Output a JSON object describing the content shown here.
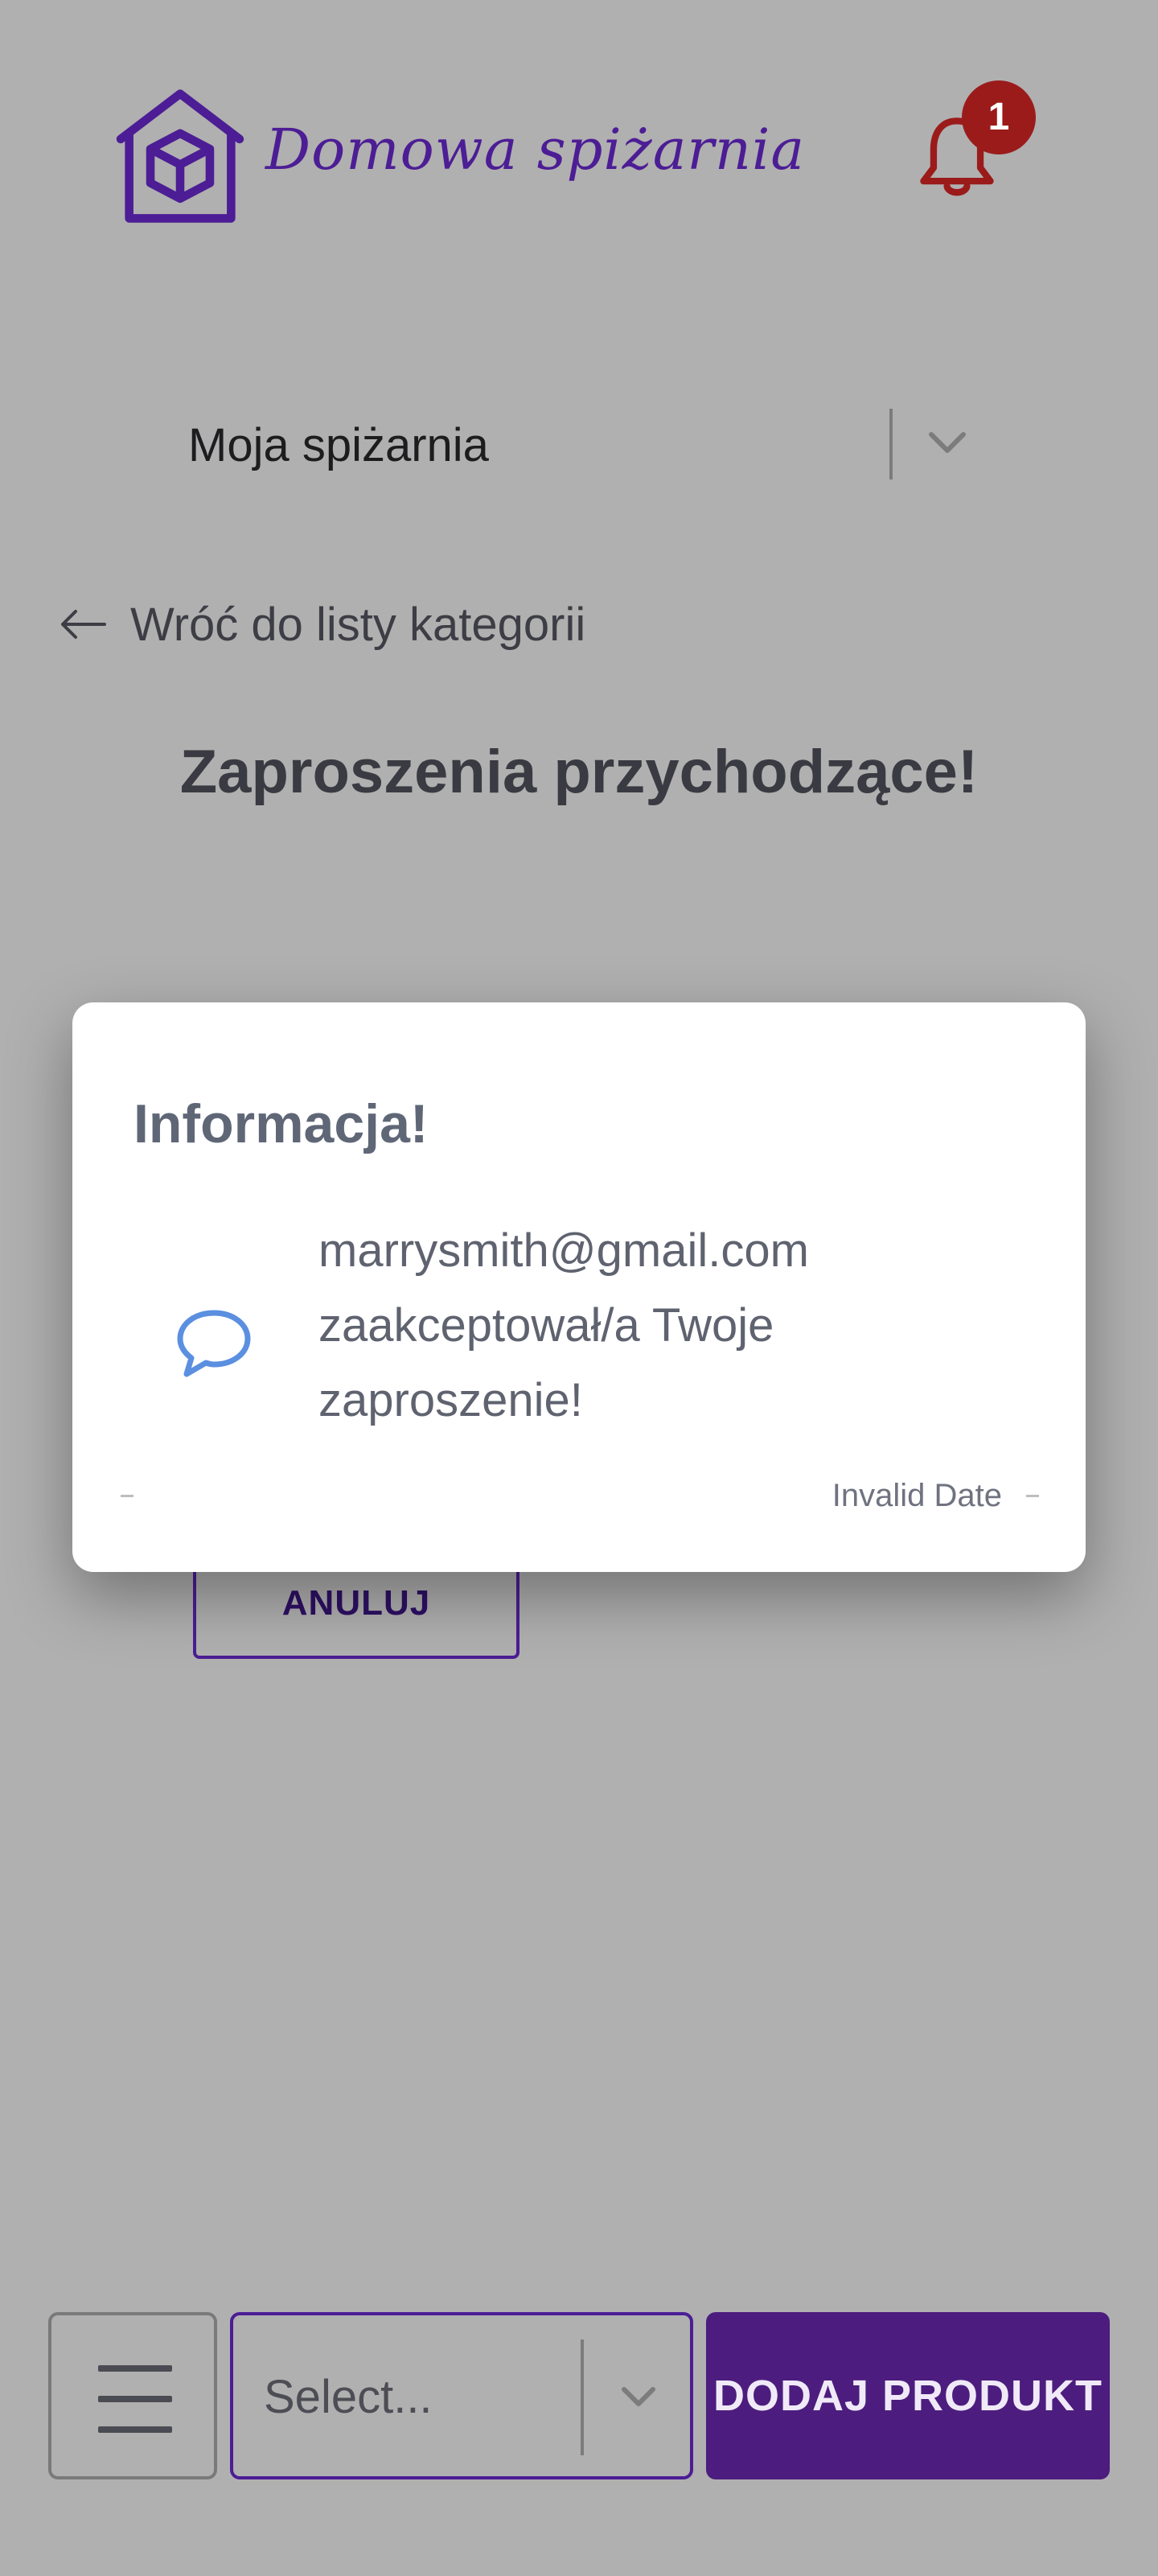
{
  "header": {
    "logo_text": "Domowa spiżarnia",
    "logo_icon": "house-box-icon",
    "notification_icon": "bell-icon",
    "notification_count": "1"
  },
  "pantry_select": {
    "value": "Moja spiżarnia"
  },
  "back_link": {
    "label": "Wróć do listy kategorii"
  },
  "page_title": "Zaproszenia przychodzące!",
  "anuluj_label": "ANULUJ",
  "modal": {
    "title": "Informacja!",
    "message": "marrysmith@gmail.com zaakceptował/a Twoje zaproszenie!",
    "date": "Invalid Date",
    "icon": "chat-bubble-icon"
  },
  "bottom_bar": {
    "select_placeholder": "Select...",
    "add_button_label": "DODAJ PRODUKT"
  },
  "colors": {
    "brand": "#4c1d95",
    "badge": "#9b1b1b",
    "overlay_bg": "#b0b0b0",
    "chat_icon": "#5b8fe0"
  }
}
